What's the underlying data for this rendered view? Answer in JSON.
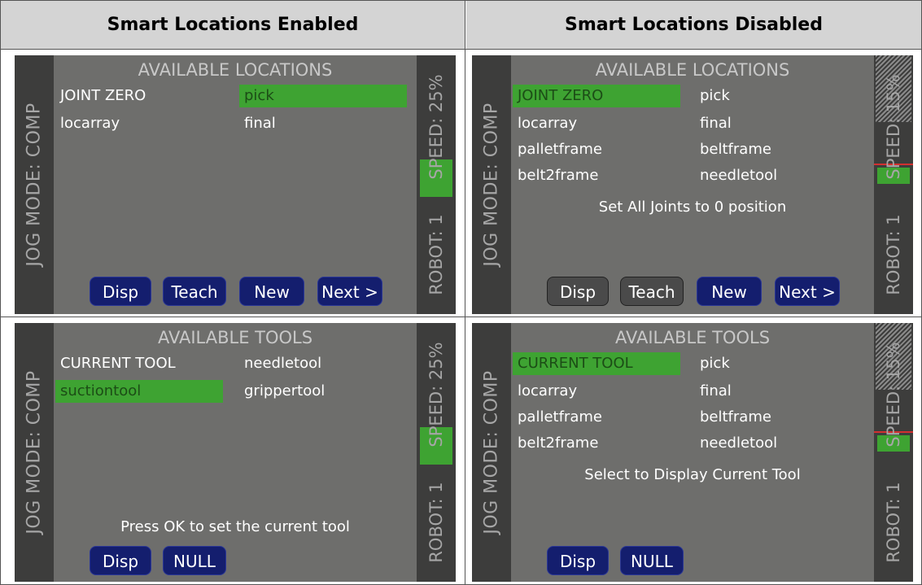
{
  "headers": {
    "left": "Smart Locations Enabled",
    "right": "Smart Locations Disabled"
  },
  "panels": {
    "tl": {
      "title": "AVAILABLE LOCATIONS",
      "jog_mode": "JOG MODE: COMP",
      "speed": "SPEED: 25%",
      "robot": "ROBOT: 1",
      "items": [
        "JOINT ZERO",
        "pick",
        "locarray",
        "final"
      ],
      "message": "",
      "buttons": [
        "Disp",
        "Teach",
        "New",
        "Next >"
      ]
    },
    "tr": {
      "title": "AVAILABLE LOCATIONS",
      "jog_mode": "JOG MODE: COMP",
      "speed": "SPEED: 15%",
      "robot": "ROBOT: 1",
      "items": [
        "JOINT ZERO",
        "pick",
        "locarray",
        "final",
        "palletframe",
        "beltframe",
        "belt2frame",
        "needletool"
      ],
      "message": "Set All Joints to 0 position",
      "buttons": [
        "Disp",
        "Teach",
        "New",
        "Next >"
      ]
    },
    "bl": {
      "title": "AVAILABLE TOOLS",
      "jog_mode": "JOG MODE: COMP",
      "speed": "SPEED: 25%",
      "robot": "ROBOT: 1",
      "items": [
        "CURRENT TOOL",
        "needletool",
        "suctiontool",
        "grippertool"
      ],
      "message": "Press OK to set the current tool",
      "buttons": [
        "Disp",
        "NULL"
      ]
    },
    "br": {
      "title": "AVAILABLE TOOLS",
      "jog_mode": "JOG MODE: COMP",
      "speed": "SPEED: 15%",
      "robot": "ROBOT: 1",
      "items": [
        "CURRENT TOOL",
        "pick",
        "locarray",
        "final",
        "palletframe",
        "beltframe",
        "belt2frame",
        "needletool"
      ],
      "message": "Select to Display Current Tool",
      "buttons": [
        "Disp",
        "NULL"
      ]
    }
  },
  "colors": {
    "selection_green": "#3ea332",
    "button_blue": "#141e6e",
    "button_gray": "#4a4a4a",
    "screen_bg": "#6e6e6c",
    "strip_bg": "#3d3d3c"
  }
}
